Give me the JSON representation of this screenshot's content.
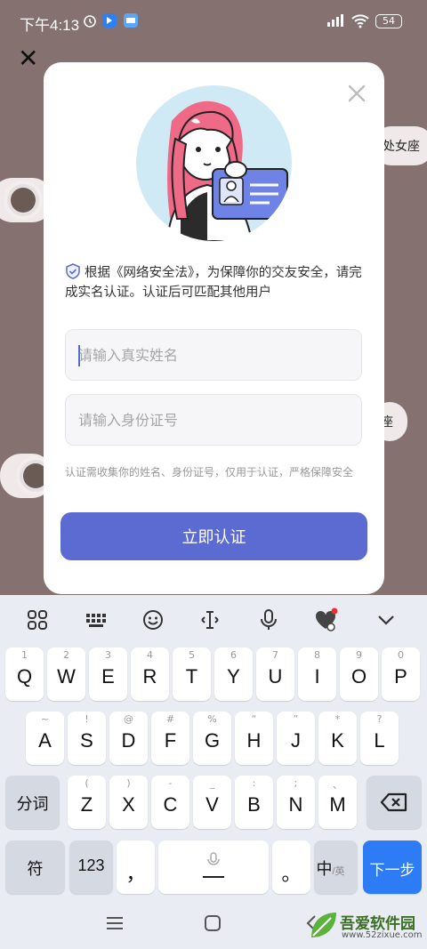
{
  "status_bar": {
    "time": "下午4:13",
    "battery": "54"
  },
  "modal": {
    "notice": "根据《网络安全法》，为保障你的交友安全，请完成实名认证。认证后可匹配其他用户",
    "name_placeholder": "请输入真实姓名",
    "id_placeholder": "请输入身份证号",
    "hint": "认证需收集你的姓名、身份证号，仅用于认证，严格保障安全",
    "submit_label": "立即认证"
  },
  "background": {
    "chip_right": "处女座",
    "chip_right2": "座"
  },
  "keyboard": {
    "row1": [
      {
        "main": "Q",
        "sub": "1"
      },
      {
        "main": "W",
        "sub": "2"
      },
      {
        "main": "E",
        "sub": "3"
      },
      {
        "main": "R",
        "sub": "4"
      },
      {
        "main": "T",
        "sub": "5"
      },
      {
        "main": "Y",
        "sub": "6"
      },
      {
        "main": "U",
        "sub": "7"
      },
      {
        "main": "I",
        "sub": "8"
      },
      {
        "main": "O",
        "sub": "9"
      },
      {
        "main": "P",
        "sub": "0"
      }
    ],
    "row2": [
      {
        "main": "A",
        "sub": "~"
      },
      {
        "main": "S",
        "sub": "!"
      },
      {
        "main": "D",
        "sub": "@"
      },
      {
        "main": "F",
        "sub": "#"
      },
      {
        "main": "G",
        "sub": "%"
      },
      {
        "main": "H",
        "sub": "“"
      },
      {
        "main": "J",
        "sub": "”"
      },
      {
        "main": "K",
        "sub": "*"
      },
      {
        "main": "L",
        "sub": "?"
      }
    ],
    "row3": [
      {
        "main": "Z",
        "sub": "("
      },
      {
        "main": "X",
        "sub": ")"
      },
      {
        "main": "C",
        "sub": "-"
      },
      {
        "main": "V",
        "sub": "_"
      },
      {
        "main": "B",
        "sub": ":"
      },
      {
        "main": "N",
        "sub": ";"
      },
      {
        "main": "M",
        "sub": "、"
      }
    ],
    "fenci_label": "分词",
    "symbol_label": "符",
    "num_label": "123",
    "comma_label": "，",
    "period_label": "。",
    "lang_label": "中",
    "lang_sub": "/英",
    "next_label": "下一步"
  },
  "watermark": {
    "text": "吾爱软件园",
    "url": "www.52zixue.com"
  },
  "icons": {
    "toolbar": [
      "grid-icon",
      "keyboard-icon",
      "emoji-icon",
      "cursor-icon",
      "mic-icon",
      "heart-icon",
      "chevron-down-icon"
    ]
  }
}
